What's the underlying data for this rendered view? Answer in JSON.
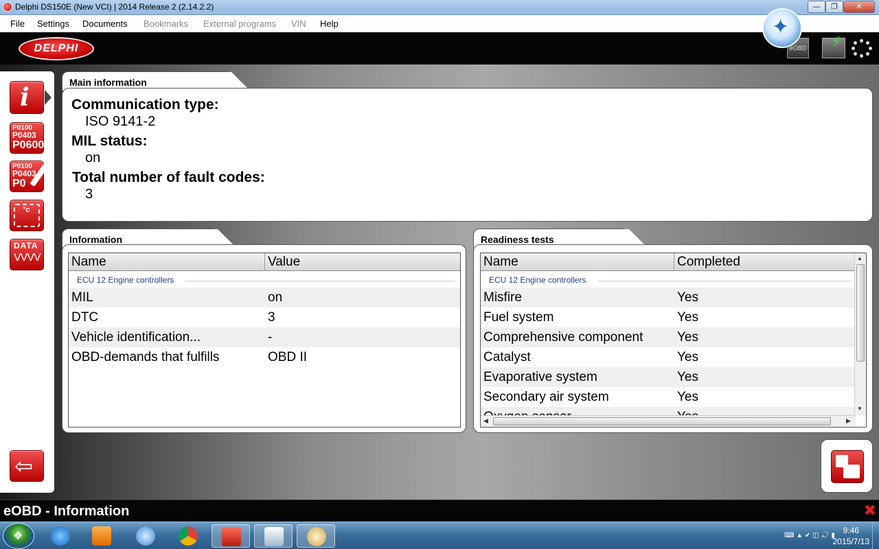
{
  "window": {
    "title": "Delphi DS150E (New VCI) | 2014 Release 2 (2.14.2.2)"
  },
  "menu": [
    {
      "label": "File",
      "disabled": false
    },
    {
      "label": "Settings",
      "disabled": false
    },
    {
      "label": "Documents",
      "disabled": false
    },
    {
      "label": "Bookmarks",
      "disabled": true
    },
    {
      "label": "External programs",
      "disabled": true
    },
    {
      "label": "VIN",
      "disabled": true
    },
    {
      "label": "Help",
      "disabled": false
    }
  ],
  "header": {
    "logo_text": "DELPHI",
    "eobd_label": "eOBD"
  },
  "sidebar": {
    "codes_lines": [
      "P0100",
      "P0403",
      "P0600"
    ],
    "clear_lines": [
      "P0100",
      "P0403",
      "P0"
    ],
    "data_label": "DATA"
  },
  "main_info": {
    "tab_title": "Main information",
    "communication_label": "Communication type:",
    "communication_value": "ISO 9141-2",
    "mil_label": "MIL status:",
    "mil_value": "on",
    "faults_label": "Total number of fault codes:",
    "faults_value": "3"
  },
  "information": {
    "tab_title": "Information",
    "columns": [
      "Name",
      "Value"
    ],
    "group": "ECU 12 Engine controllers",
    "rows": [
      {
        "name": "MIL",
        "value": "on"
      },
      {
        "name": "DTC",
        "value": "3"
      },
      {
        "name": "Vehicle identification...",
        "value": "-"
      },
      {
        "name": "OBD-demands that fulfills",
        "value": "OBD II"
      }
    ]
  },
  "readiness": {
    "tab_title": "Readiness tests",
    "columns": [
      "Name",
      "Completed"
    ],
    "group": "ECU 12 Engine controllers",
    "rows": [
      {
        "name": "Misfire",
        "value": "Yes"
      },
      {
        "name": "Fuel system",
        "value": "Yes"
      },
      {
        "name": "Comprehensive component",
        "value": "Yes"
      },
      {
        "name": "Catalyst",
        "value": "Yes"
      },
      {
        "name": "Evaporative system",
        "value": "Yes"
      },
      {
        "name": "Secondary air system",
        "value": "Yes"
      },
      {
        "name": "Oxygen sensor",
        "value": "Yes"
      }
    ]
  },
  "status": {
    "title": "eOBD - Information"
  },
  "taskbar": {
    "time": "9:46",
    "date": "2015/7/13"
  },
  "colors": {
    "accent_red": "#c10000",
    "header_bg": "#050505",
    "group_text": "#21408f"
  }
}
